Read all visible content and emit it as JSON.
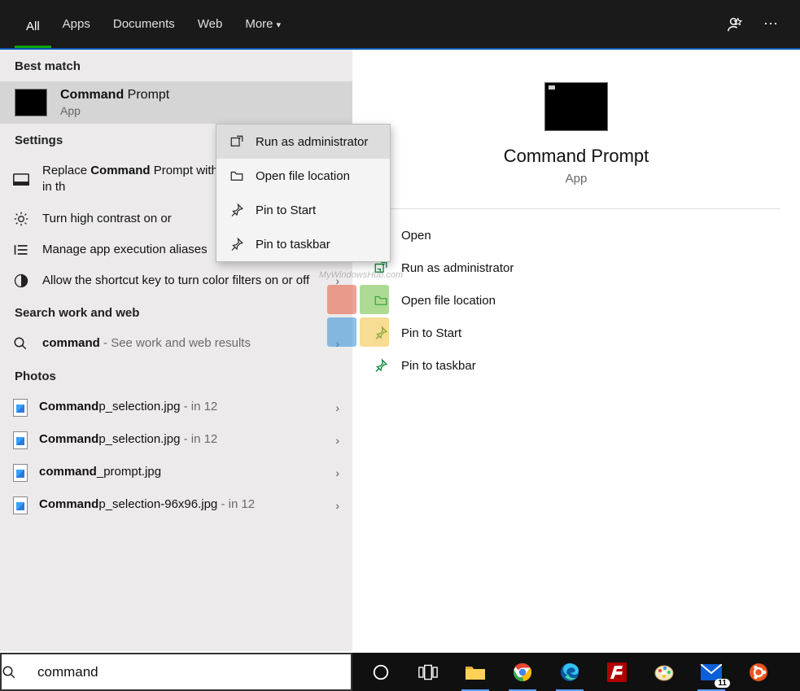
{
  "topbar": {
    "tabs": [
      "All",
      "Apps",
      "Documents",
      "Web",
      "More"
    ]
  },
  "sections": {
    "best_match": "Best match",
    "settings": "Settings",
    "search_web": "Search work and web",
    "photos": "Photos"
  },
  "best_match": {
    "title_bold": "Command",
    "title_rest": " Prompt",
    "subtitle": "App"
  },
  "settings_results": [
    {
      "icon": "terminal",
      "pre": "Replace ",
      "bold": "Command",
      "post": " Prompt with Windows PowerShell in th"
    },
    {
      "icon": "brightness",
      "pre": "Turn high contrast on or ",
      "bold": "",
      "post": ""
    },
    {
      "icon": "list",
      "pre": "Manage app execution aliases",
      "bold": "",
      "post": "",
      "chev": true
    },
    {
      "icon": "colorfilter",
      "pre": "Allow the shortcut key to turn color filters on or off",
      "bold": "",
      "post": "",
      "chev": true
    }
  ],
  "web_result": {
    "bold": "command",
    "suffix": " - See work and web results"
  },
  "photos": [
    {
      "bold": "Command",
      "rest": "p_selection.jpg",
      "loc": " - in 12"
    },
    {
      "bold": "Command",
      "rest": "p_selection.jpg",
      "loc": " - in 12"
    },
    {
      "bold": "command",
      "rest": "_prompt.jpg",
      "loc": ""
    },
    {
      "bold": "Command",
      "rest": "p_selection-96x96.jpg",
      "loc": " - in 12"
    }
  ],
  "context_menu": [
    "Run as administrator",
    "Open file location",
    "Pin to Start",
    "Pin to taskbar"
  ],
  "preview": {
    "title": "Command Prompt",
    "subtitle": "App",
    "actions": [
      "Open",
      "Run as administrator",
      "Open file location",
      "Pin to Start",
      "Pin to taskbar"
    ]
  },
  "search": {
    "value": "command"
  },
  "watermark": "MyWindowsHub.com",
  "mail_badge": "11"
}
